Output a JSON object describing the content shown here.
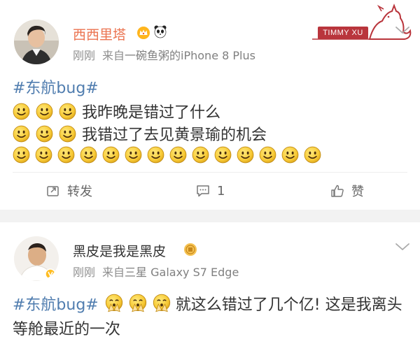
{
  "posts": [
    {
      "user": {
        "name": "西西里塔"
      },
      "meta": {
        "time": "刚刚",
        "source_prefix": "来自",
        "source": "一碗鱼粥的iPhone 8 Plus"
      },
      "hashtag": "#东航bug#",
      "lines": [
        "我昨晚是错过了什么",
        "我错过了去见黄景瑜的机会"
      ],
      "emoji_row_count": 14,
      "actions": {
        "repost": "转发",
        "comment": "1",
        "like": "赞"
      }
    },
    {
      "user": {
        "name": "黑皮是我是黑皮"
      },
      "meta": {
        "time": "刚刚",
        "source_prefix": "来自",
        "source_brand": "三星",
        "source_model": " Galaxy S7 Edge"
      },
      "hashtag": "#东航bug#",
      "text_line1": "就这么错过了几个亿! 这是我离头",
      "text_line2": "等舱最近的一次"
    }
  ],
  "watermark": {
    "text": "TIMMY XU"
  },
  "icons": {
    "smile": "smile-emoji-icon",
    "pray": "praying-emoji-icon",
    "repost": "repost-icon",
    "comment": "comment-icon",
    "like": "thumbs-up-icon",
    "more": "chevron-down-icon",
    "vip": "vip-crown-icon",
    "panda": "panda-icon",
    "medal": "medal-icon"
  },
  "colors": {
    "username": "#eb7350",
    "hashtag": "#507daf",
    "meta": "#8f8f8f",
    "text": "#333333",
    "background": "#f2f2f2"
  }
}
